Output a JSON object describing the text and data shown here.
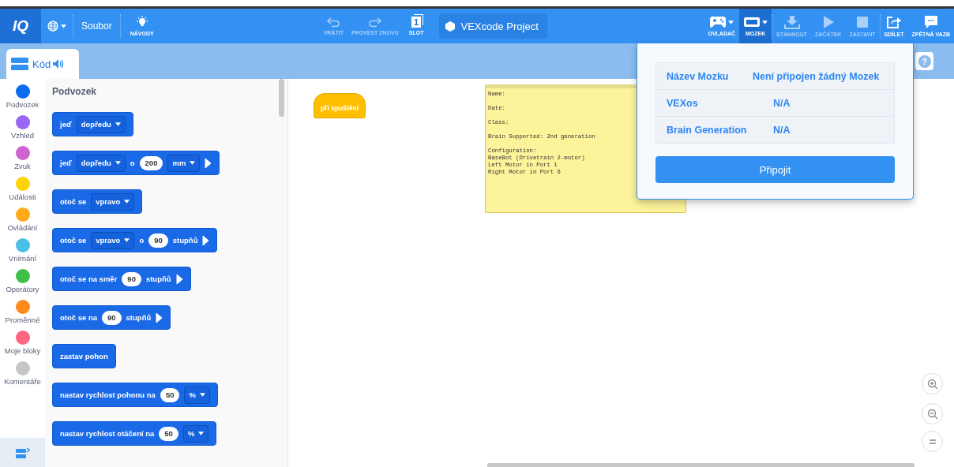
{
  "toolbar": {
    "logo": "IQ",
    "file_menu": "Soubor",
    "tutorials": "NÁVODY",
    "history": [
      {
        "kind": "undo",
        "label": "VRÁTIT",
        "disabled": true
      },
      {
        "kind": "redo",
        "label": "PROVÉST ZNOVU",
        "disabled": true
      }
    ],
    "slot": {
      "number": "1",
      "label": "SLOT"
    },
    "project_name": "VEXcode Project",
    "tools": [
      {
        "kind": "controller",
        "label": "OVLADAČ",
        "selected": false,
        "disabled": false
      },
      {
        "kind": "brain",
        "label": "MOZEK",
        "selected": true,
        "disabled": false
      },
      {
        "kind": "download",
        "label": "STÁHNOUT",
        "selected": false,
        "disabled": true
      },
      {
        "kind": "start",
        "label": "ZAČÁTEK",
        "selected": false,
        "disabled": true
      },
      {
        "kind": "stop",
        "label": "ZASTAVIT",
        "selected": false,
        "disabled": true
      },
      {
        "kind": "share",
        "label": "SDÍLET",
        "selected": false,
        "disabled": false
      },
      {
        "kind": "feedback",
        "label": "ZPĚTNÁ VAZB",
        "selected": false,
        "disabled": false
      }
    ]
  },
  "tabs": [
    {
      "label": "Kód",
      "selected": true
    }
  ],
  "help_button": "?",
  "categories": [
    {
      "name": "Podvozek",
      "color": "#0c6cf2"
    },
    {
      "name": "Vzhled",
      "color": "#9a66f5"
    },
    {
      "name": "Zvuk",
      "color": "#cf63cf"
    },
    {
      "name": "Události",
      "color": "#ffd500"
    },
    {
      "name": "Ovládání",
      "color": "#ffab19"
    },
    {
      "name": "Vnímání",
      "color": "#4cbfe6"
    },
    {
      "name": "Operátory",
      "color": "#40bf4a"
    },
    {
      "name": "Proměnné",
      "color": "#ff8c1a"
    },
    {
      "name": "Moje bloky",
      "color": "#ff6680"
    },
    {
      "name": "Komentáře",
      "color": "#c6c6c6"
    }
  ],
  "palette": {
    "title": "Podvozek",
    "blocks": [
      {
        "parts": [
          {
            "kind": "text",
            "text": "jeď"
          },
          {
            "kind": "dropdown",
            "text": "dopředu"
          }
        ]
      },
      {
        "parts": [
          {
            "kind": "text",
            "text": "jeď"
          },
          {
            "kind": "dropdown",
            "text": "dopředu"
          },
          {
            "kind": "text",
            "text": "o"
          },
          {
            "kind": "number",
            "text": "200"
          },
          {
            "kind": "dropdown",
            "text": "mm"
          },
          {
            "kind": "expand"
          }
        ]
      },
      {
        "parts": [
          {
            "kind": "text",
            "text": "otoč se"
          },
          {
            "kind": "dropdown",
            "text": "vpravo"
          }
        ]
      },
      {
        "parts": [
          {
            "kind": "text",
            "text": "otoč se"
          },
          {
            "kind": "dropdown",
            "text": "vpravo"
          },
          {
            "kind": "text",
            "text": "o"
          },
          {
            "kind": "number",
            "text": "90"
          },
          {
            "kind": "text",
            "text": "stupňů"
          },
          {
            "kind": "expand"
          }
        ]
      },
      {
        "parts": [
          {
            "kind": "text",
            "text": "otoč se na směr"
          },
          {
            "kind": "number",
            "text": "90"
          },
          {
            "kind": "text",
            "text": "stupňů"
          },
          {
            "kind": "expand"
          }
        ]
      },
      {
        "parts": [
          {
            "kind": "text",
            "text": "otoč se na"
          },
          {
            "kind": "number",
            "text": "90"
          },
          {
            "kind": "text",
            "text": "stupňů"
          },
          {
            "kind": "expand"
          }
        ]
      },
      {
        "parts": [
          {
            "kind": "text",
            "text": "zastav pohon"
          }
        ]
      },
      {
        "parts": [
          {
            "kind": "text",
            "text": "nastav rychlost pohonu na"
          },
          {
            "kind": "number",
            "text": "50"
          },
          {
            "kind": "dropdown",
            "text": "%"
          }
        ]
      },
      {
        "parts": [
          {
            "kind": "text",
            "text": "nastav rychlost otáčení na"
          },
          {
            "kind": "number",
            "text": "50"
          },
          {
            "kind": "dropdown",
            "text": "%"
          }
        ]
      }
    ]
  },
  "canvas": {
    "hat_block": "při spuštění",
    "note": "Name:\n\nDate:\n\nClass:\n\nBrain Supported: 2nd generation\n\nConfiguration:\nBaseBot (Drivetrain 2-motor)\nLeft Motor in Port 1\nRight Motor in Port 6"
  },
  "brain_popup": {
    "rows": [
      {
        "label": "Název Mozku",
        "value": "Není připojen žádný Mozek"
      },
      {
        "label": "VEXos",
        "value": "N/A"
      },
      {
        "label": "Brain Generation",
        "value": "N/A"
      }
    ],
    "button": "Připojit"
  }
}
